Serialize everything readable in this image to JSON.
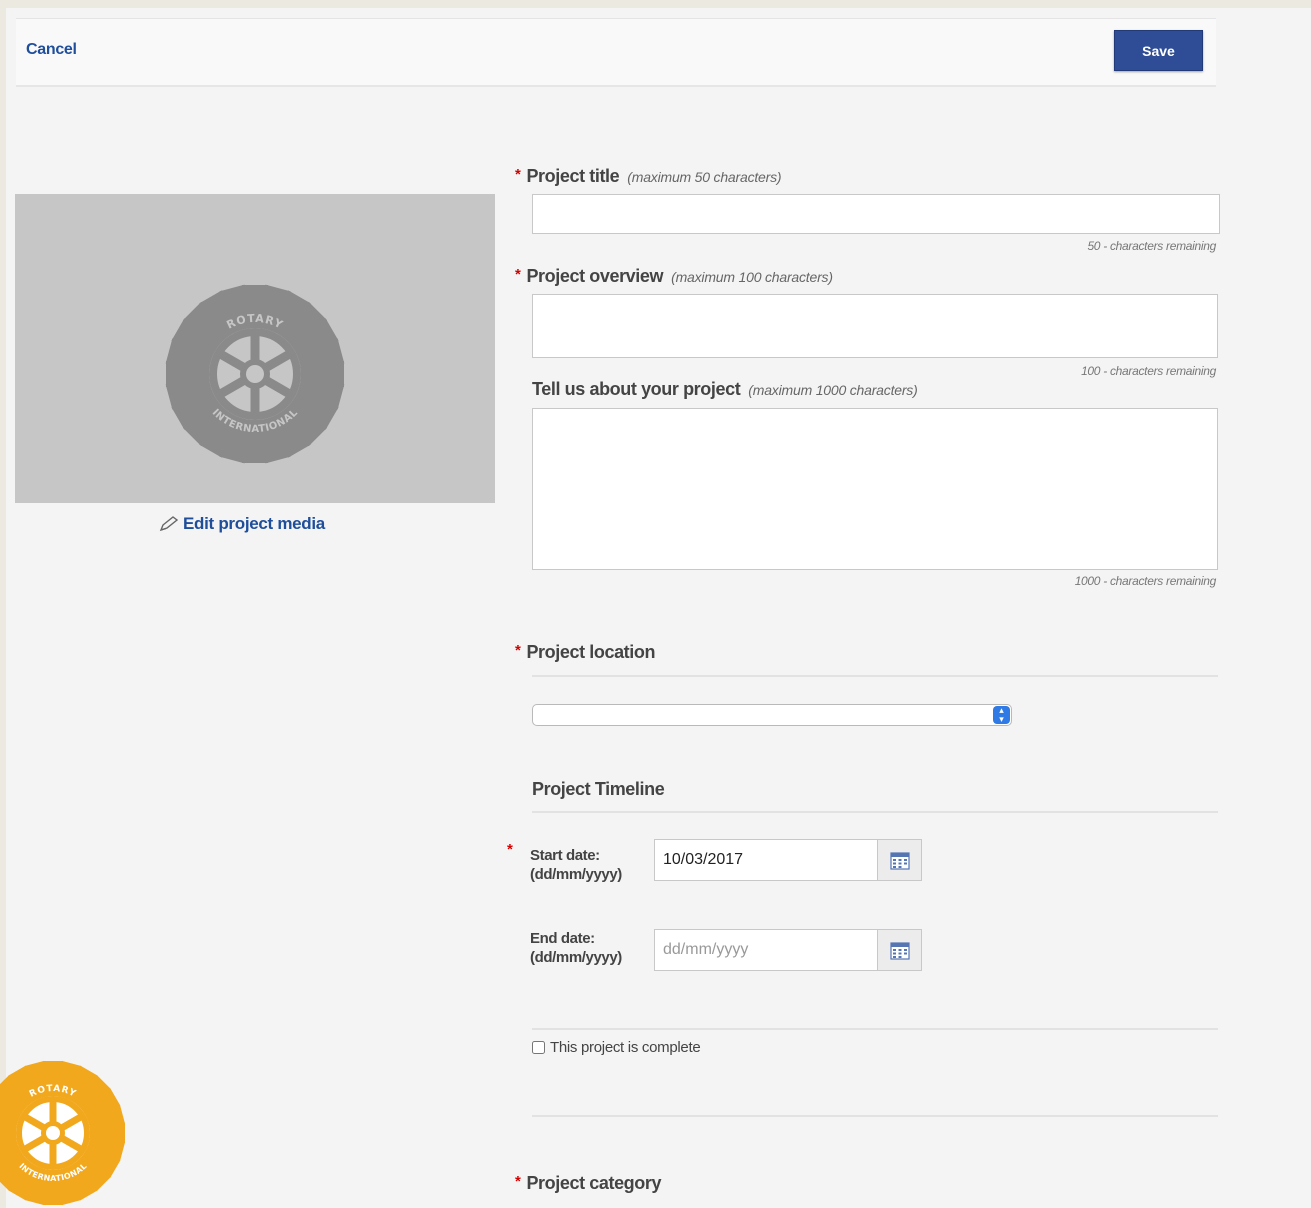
{
  "toolbar": {
    "cancel_label": "Cancel",
    "save_label": "Save"
  },
  "media": {
    "edit_label": "Edit project media",
    "logo_text_top": "ROTARY",
    "logo_text_bottom": "INTERNATIONAL"
  },
  "form": {
    "title": {
      "required_mark": "*",
      "label": "Project title",
      "hint": "(maximum 50 characters)",
      "value": "",
      "counter": "50 - characters remaining"
    },
    "overview": {
      "required_mark": "*",
      "label": "Project overview",
      "hint": "(maximum 100 characters)",
      "value": "",
      "counter": "100 - characters remaining"
    },
    "about": {
      "label": "Tell us about your project",
      "hint": "(maximum 1000 characters)",
      "value": "",
      "counter": "1000 - characters remaining"
    },
    "location": {
      "required_mark": "*",
      "label": "Project location",
      "selected": ""
    },
    "timeline": {
      "heading": "Project Timeline",
      "start": {
        "required_mark": "*",
        "label": "Start date:",
        "format": "(dd/mm/yyyy)",
        "value": "10/03/2017",
        "placeholder": "dd/mm/yyyy"
      },
      "end": {
        "label": "End date:",
        "format": "(dd/mm/yyyy)",
        "value": "",
        "placeholder": "dd/mm/yyyy"
      },
      "complete_label": "This project is complete",
      "complete_checked": false
    },
    "category": {
      "required_mark": "*",
      "label": "Project category"
    }
  },
  "colors": {
    "link": "#1f4e9b",
    "save_button": "#2e4d96",
    "required": "#d40000",
    "placeholder_box": "#c6c6c6",
    "emblem_grey": "#8a8a8a",
    "logo_gold": "#f2a81d",
    "select_arrow": "#2f7ae5"
  }
}
